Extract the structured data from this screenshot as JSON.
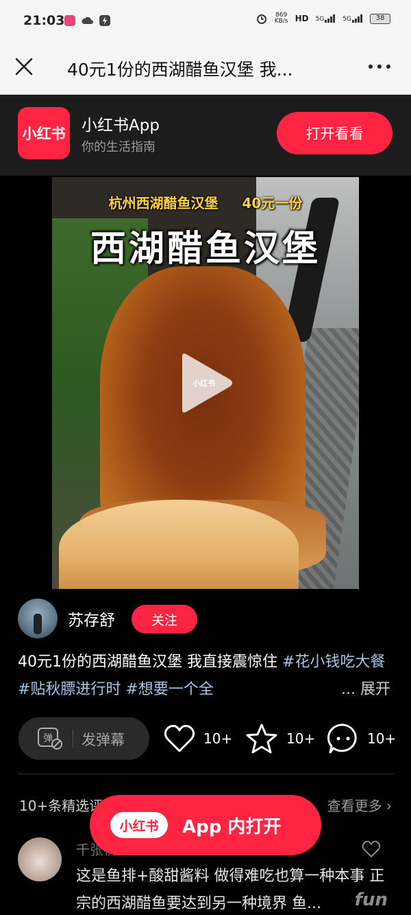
{
  "status_bar": {
    "time": "21:03",
    "net_speed_value": "869",
    "net_speed_unit": "KB/s",
    "hd_label": "HD",
    "signal1": "5G",
    "signal2": "5G",
    "battery": "38"
  },
  "navbar": {
    "title": "40元1份的西湖醋鱼汉堡 我..."
  },
  "banner": {
    "logo_text": "小红书",
    "app_name": "小红书App",
    "tagline": "你的生活指南",
    "open_button": "打开看看"
  },
  "video": {
    "caption_small": "杭州西湖醋鱼汉堡     40元一份",
    "caption_big": "西湖醋鱼汉堡",
    "play_watermark": "小红书"
  },
  "author": {
    "name": "苏存舒",
    "follow_label": "关注"
  },
  "description": {
    "text": "40元1份的西湖醋鱼汉堡 我直接震惊住 ",
    "tag1": "#花小钱吃大餐",
    "tag2": "#贴秋膘进行时",
    "tag3": "#想要一个全",
    "expand": "... 展开"
  },
  "actions": {
    "danmaku_label": "发弹幕",
    "like_count": "10+",
    "collect_count": "10+",
    "comment_count": "10+"
  },
  "comments": {
    "header": "10+条精选评论",
    "view_more": "查看更多",
    "first": {
      "name": "千张桃",
      "text": "这是鱼排+酸甜酱料 做得难吃也算一种本事 正宗的西湖醋鱼要达到另一种境界 鱼..."
    }
  },
  "float_button": {
    "logo_text": "小红书",
    "label": "App 内打开"
  },
  "watermark": "fun",
  "colors": {
    "accent": "#ff2442",
    "tag": "#a6c4e8",
    "background": "#000000"
  }
}
